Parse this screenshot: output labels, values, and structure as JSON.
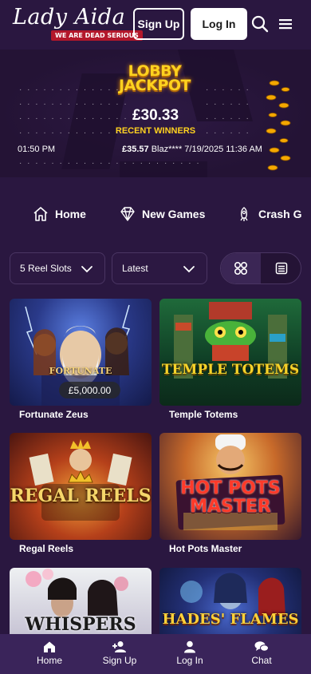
{
  "header": {
    "logo_text": "Lady Aida",
    "logo_tagline": "WE ARE DEAD SERIOUS",
    "signup_label": "Sign Up",
    "login_label": "Log In",
    "search_icon": "search-icon",
    "menu_icon": "hamburger-menu-icon"
  },
  "jackpot": {
    "title_line1": "LOBBY",
    "title_line2": "JACKPOT",
    "amount": "£30.33",
    "recent_label": "RECENT WINNERS",
    "ticker_left": "01:50 PM",
    "ticker_amount": "£35.57",
    "ticker_rest": "Blaz**** 7/19/2025 11:36 AM"
  },
  "categories": [
    {
      "label": "Home",
      "icon": "home-icon"
    },
    {
      "label": "New Games",
      "icon": "diamond-icon"
    },
    {
      "label": "Crash G",
      "icon": "rocket-icon"
    }
  ],
  "filters": {
    "type_select": "5 Reel Slots",
    "sort_select": "Latest",
    "grid_view_icon": "grid-view-icon",
    "list_view_icon": "list-view-icon"
  },
  "games": [
    {
      "name": "Fortunate Zeus",
      "art_title": "FORTUNATE",
      "prize": "£5,000.00"
    },
    {
      "name": "Temple Totems",
      "art_title": "TEMPLE TOTEMS"
    },
    {
      "name": "Regal Reels",
      "art_title": "REGAL REELS"
    },
    {
      "name": "Hot Pots Master",
      "art_title": "HOT POTS MASTER"
    },
    {
      "name": "",
      "art_title": "WHISPERS"
    },
    {
      "name": "",
      "art_title": "HADES' FLAMES"
    }
  ],
  "bottom_nav": [
    {
      "label": "Home",
      "icon": "home-icon"
    },
    {
      "label": "Sign Up",
      "icon": "add-user-icon"
    },
    {
      "label": "Log In",
      "icon": "user-icon"
    },
    {
      "label": "Chat",
      "icon": "chat-icon"
    }
  ],
  "colors": {
    "background": "#2a1740",
    "accent_gold": "#ffd21f",
    "bottom_nav": "#3a245a"
  }
}
